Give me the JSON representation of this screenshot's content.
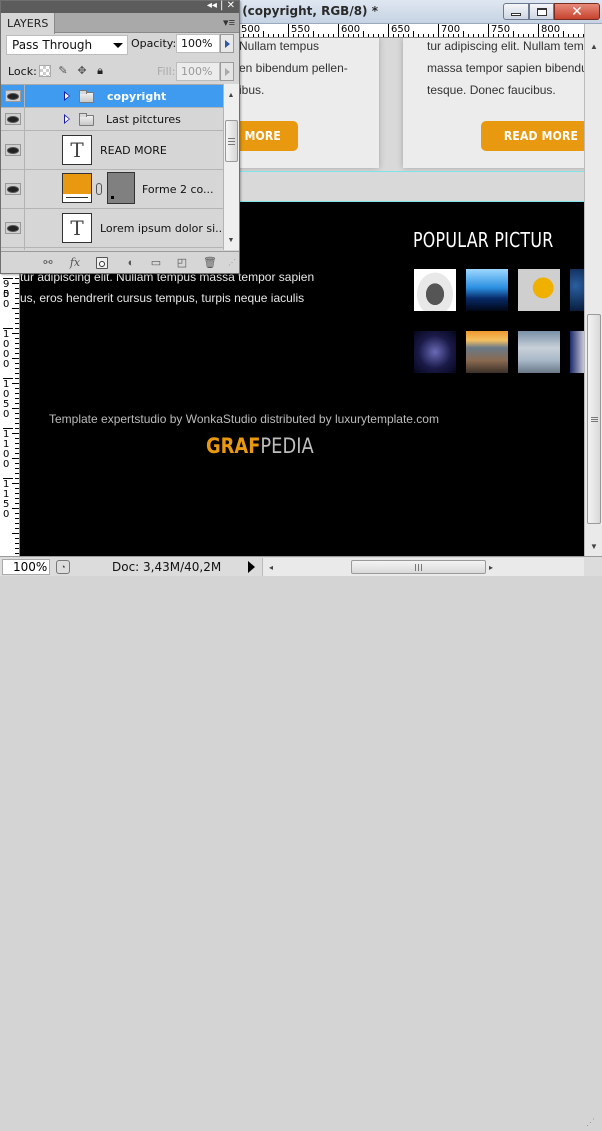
{
  "document": {
    "title": "% (copyright, RGB/8) *",
    "zoom": "100%",
    "doc_info": "Doc: 3,43M/40,2M",
    "window_controls": {
      "minimize": "minimize-icon",
      "maximize": "maximize-icon",
      "close": "close-icon"
    },
    "h_ruler_labels": [
      "500",
      "550",
      "600",
      "650",
      "700",
      "750",
      "800"
    ],
    "v_ruler_labels": [
      "950",
      "1000",
      "1050",
      "1100",
      "1150"
    ]
  },
  "canvas": {
    "card_left_lines": [
      "Nullam tempus",
      "en bibendum pellen-",
      "ibus."
    ],
    "card_right_lines": [
      "tur adipiscing elit. Nullam tempus",
      "massa tempor sapien bibendum pellen-",
      "tesque. Donec faucibus."
    ],
    "read_more": "READ MORE",
    "read_more_left_partial": "MORE",
    "dark_lines": [
      "tur adipiscing elit. Nullam tempus massa tempor sapien",
      "us, eros hendrerit cursus tempus, turpis neque iaculis"
    ],
    "popular_title": "POPULAR PICTUR",
    "thumbnails_row1": [
      "car",
      "concert-crowd",
      "hard-hat",
      "blue-space"
    ],
    "thumbnails_row2": [
      "nebula",
      "rocky-sunset",
      "dancer",
      "portrait"
    ],
    "credit": "Template expertstudio by WonkaStudio distributed by luxurytemplate.com",
    "logo_a": "GRAF",
    "logo_b": "PEDIA",
    "accent_color": "#e8990f"
  },
  "layers_panel": {
    "tab": "LAYERS",
    "collapse_ctrl": "◂◂ | ✕",
    "blend_mode": "Pass Through",
    "opacity_label": "Opacity:",
    "opacity": "100%",
    "lock_label": "Lock:",
    "fill_label": "Fill:",
    "fill": "100%",
    "layers": [
      {
        "name": "copyright",
        "type": "group",
        "visible": true,
        "selected": true
      },
      {
        "name": "Last pitctures",
        "type": "group",
        "visible": true,
        "selected": false
      },
      {
        "name": "READ MORE",
        "type": "text",
        "visible": true,
        "selected": false
      },
      {
        "name": "Forme 2 co...",
        "type": "shape",
        "visible": true,
        "selected": false
      },
      {
        "name": "Lorem ipsum dolor si...",
        "type": "text",
        "visible": true,
        "selected": false
      }
    ],
    "bottom_icons": [
      "link-layers-icon",
      "fx-icon",
      "add-mask-icon",
      "adjustment-layer-icon",
      "new-group-icon",
      "new-layer-icon",
      "delete-layer-icon"
    ]
  }
}
